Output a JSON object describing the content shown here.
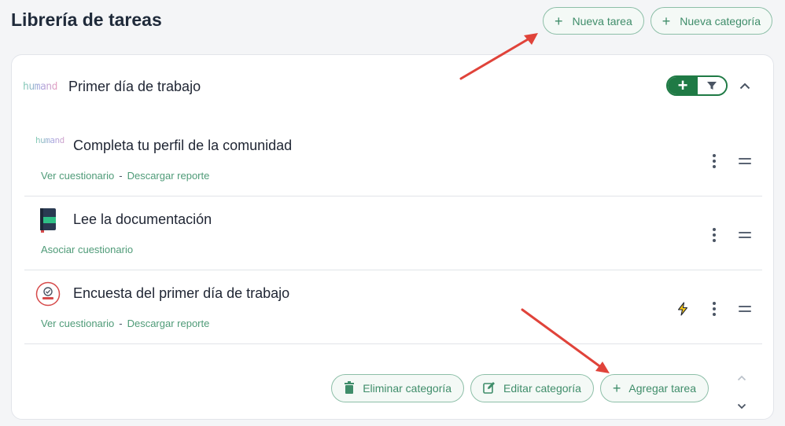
{
  "header": {
    "title": "Librería de tareas",
    "new_task_label": "Nueva tarea",
    "new_category_label": "Nueva categoría"
  },
  "category": {
    "logo_text": "humand",
    "title": "Primer día de trabajo",
    "toggle_plus": "+"
  },
  "tasks": [
    {
      "icon": "humand-logo",
      "title": "Completa tu perfil de la comunidad",
      "links": [
        "Ver cuestionario",
        "Descargar reporte"
      ],
      "separator": "-"
    },
    {
      "icon": "book-icon",
      "title": "Lee la documentación",
      "links": [
        "Asociar cuestionario"
      ]
    },
    {
      "icon": "calidad-badge-icon",
      "title": "Encuesta del primer día de trabajo",
      "links": [
        "Ver cuestionario",
        "Descargar reporte"
      ],
      "separator": "-",
      "has_automation": true
    }
  ],
  "footer": {
    "delete_category_label": "Eliminar categoría",
    "edit_category_label": "Editar categoría",
    "add_task_label": "Agregar tarea"
  },
  "colors": {
    "accent_green": "#3f8d6a",
    "dark_green": "#1f7a45",
    "annotation_red": "#e0433a"
  }
}
